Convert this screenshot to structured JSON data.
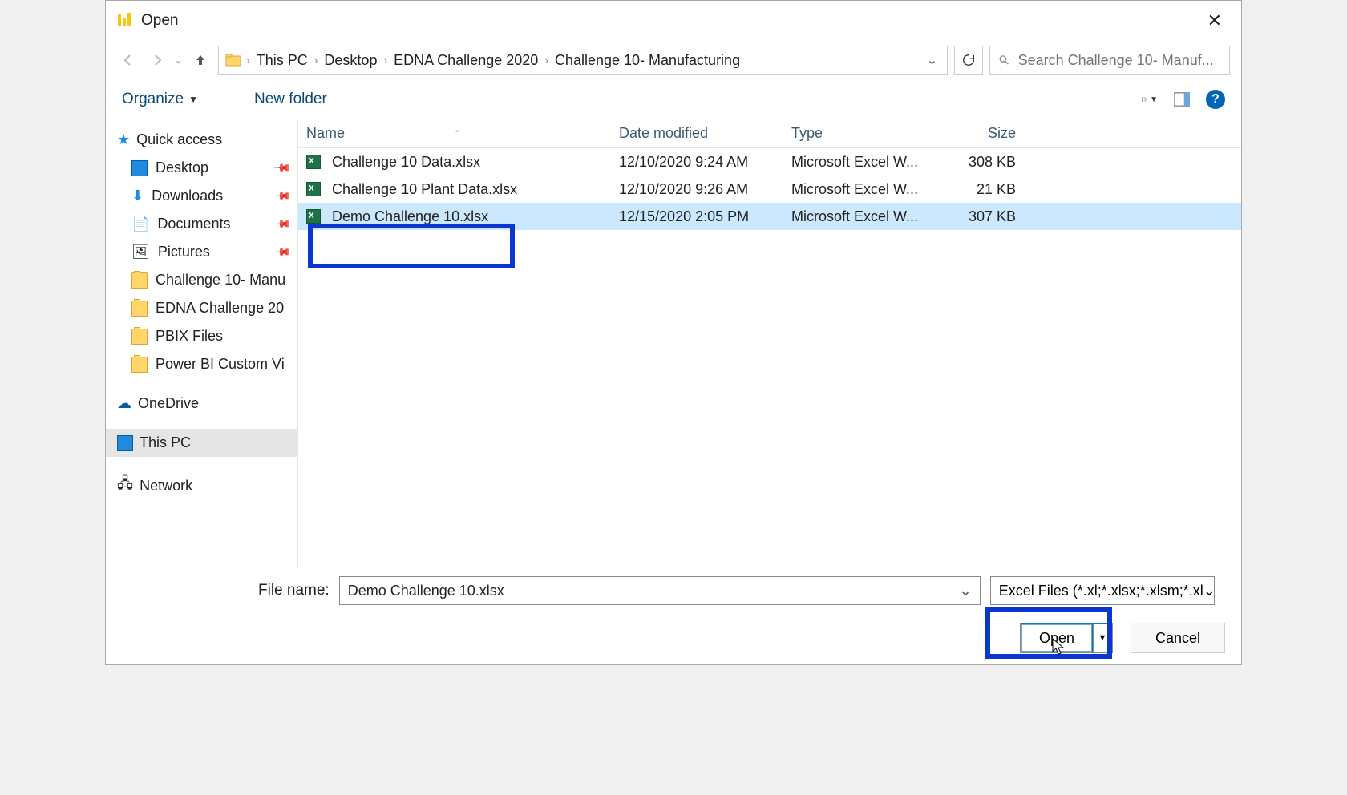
{
  "window": {
    "title": "Open"
  },
  "breadcrumb": {
    "items": [
      "This PC",
      "Desktop",
      "EDNA Challenge 2020",
      "Challenge 10- Manufacturing"
    ]
  },
  "search": {
    "placeholder": "Search Challenge 10- Manuf..."
  },
  "toolbar": {
    "organize": "Organize",
    "newfolder": "New folder"
  },
  "sidebar": {
    "quick": "Quick access",
    "items": [
      {
        "label": "Desktop",
        "pin": true
      },
      {
        "label": "Downloads",
        "pin": true
      },
      {
        "label": "Documents",
        "pin": true
      },
      {
        "label": "Pictures",
        "pin": true
      },
      {
        "label": "Challenge 10- Manu",
        "pin": false
      },
      {
        "label": "EDNA Challenge 20",
        "pin": false
      },
      {
        "label": "PBIX Files",
        "pin": false
      },
      {
        "label": "Power BI Custom Vi",
        "pin": false
      }
    ],
    "onedrive": "OneDrive",
    "thispc": "This PC",
    "network": "Network"
  },
  "columns": {
    "name": "Name",
    "date": "Date modified",
    "type": "Type",
    "size": "Size"
  },
  "files": [
    {
      "name": "Challenge 10 Data.xlsx",
      "date": "12/10/2020 9:24 AM",
      "type": "Microsoft Excel W...",
      "size": "308 KB"
    },
    {
      "name": "Challenge 10 Plant Data.xlsx",
      "date": "12/10/2020 9:26 AM",
      "type": "Microsoft Excel W...",
      "size": "21 KB"
    },
    {
      "name": "Demo Challenge 10.xlsx",
      "date": "12/15/2020 2:05 PM",
      "type": "Microsoft Excel W...",
      "size": "307 KB"
    }
  ],
  "footer": {
    "filename_label": "File name:",
    "filename_value": "Demo Challenge 10.xlsx",
    "filter": "Excel Files (*.xl;*.xlsx;*.xlsm;*.xl",
    "open": "Open",
    "cancel": "Cancel"
  }
}
